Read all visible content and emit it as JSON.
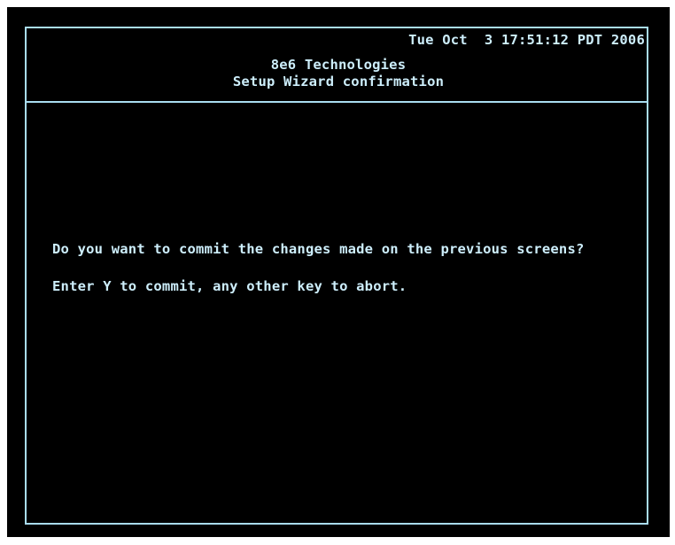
{
  "header": {
    "datetime": "Tue Oct  3 17:51:12 PDT 2006",
    "company": "8e6 Technologies",
    "title": "Setup Wizard confirmation"
  },
  "body": {
    "prompt": "Do you want to commit the changes made on the previous screens?",
    "instruction": "Enter Y to commit, any other key to abort."
  },
  "colors": {
    "background": "#000000",
    "foreground": "#cdeefb",
    "border": "#a9dcf0"
  }
}
